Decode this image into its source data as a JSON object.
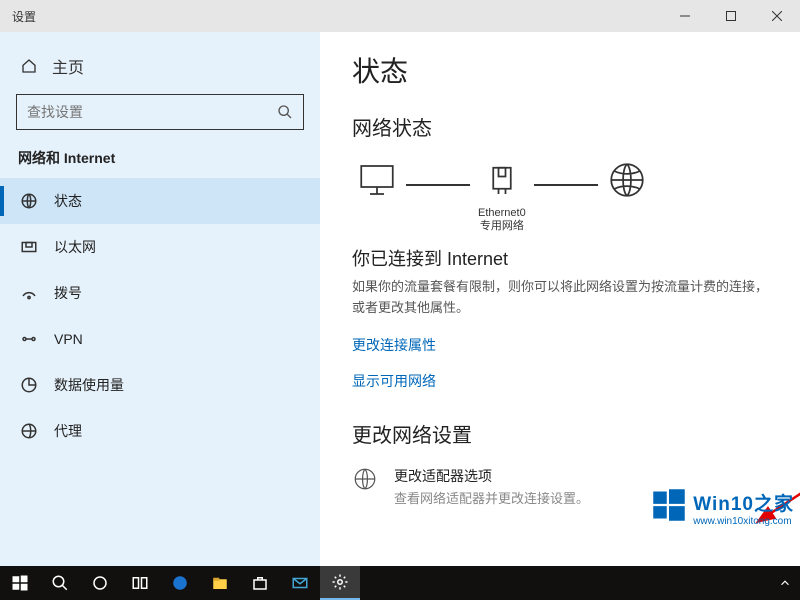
{
  "titlebar": {
    "title": "设置"
  },
  "sidebar": {
    "home": "主页",
    "search_placeholder": "查找设置",
    "category": "网络和 Internet",
    "items": [
      {
        "label": "状态"
      },
      {
        "label": "以太网"
      },
      {
        "label": "拨号"
      },
      {
        "label": "VPN"
      },
      {
        "label": "数据使用量"
      },
      {
        "label": "代理"
      }
    ]
  },
  "content": {
    "page_title": "状态",
    "network_status_title": "网络状态",
    "diagram": {
      "device_label": "Ethernet0\n专用网络"
    },
    "connected_title": "你已连接到 Internet",
    "connected_desc": "如果你的流量套餐有限制，则你可以将此网络设置为按流量计费的连接，或者更改其他属性。",
    "link_properties": "更改连接属性",
    "link_networks": "显示可用网络",
    "change_settings_title": "更改网络设置",
    "adapter_option_title": "更改适配器选项",
    "adapter_option_desc": "查看网络适配器并更改连接设置。"
  },
  "watermark": {
    "big": "Win10之家",
    "small": "www.win10xitong.com"
  }
}
